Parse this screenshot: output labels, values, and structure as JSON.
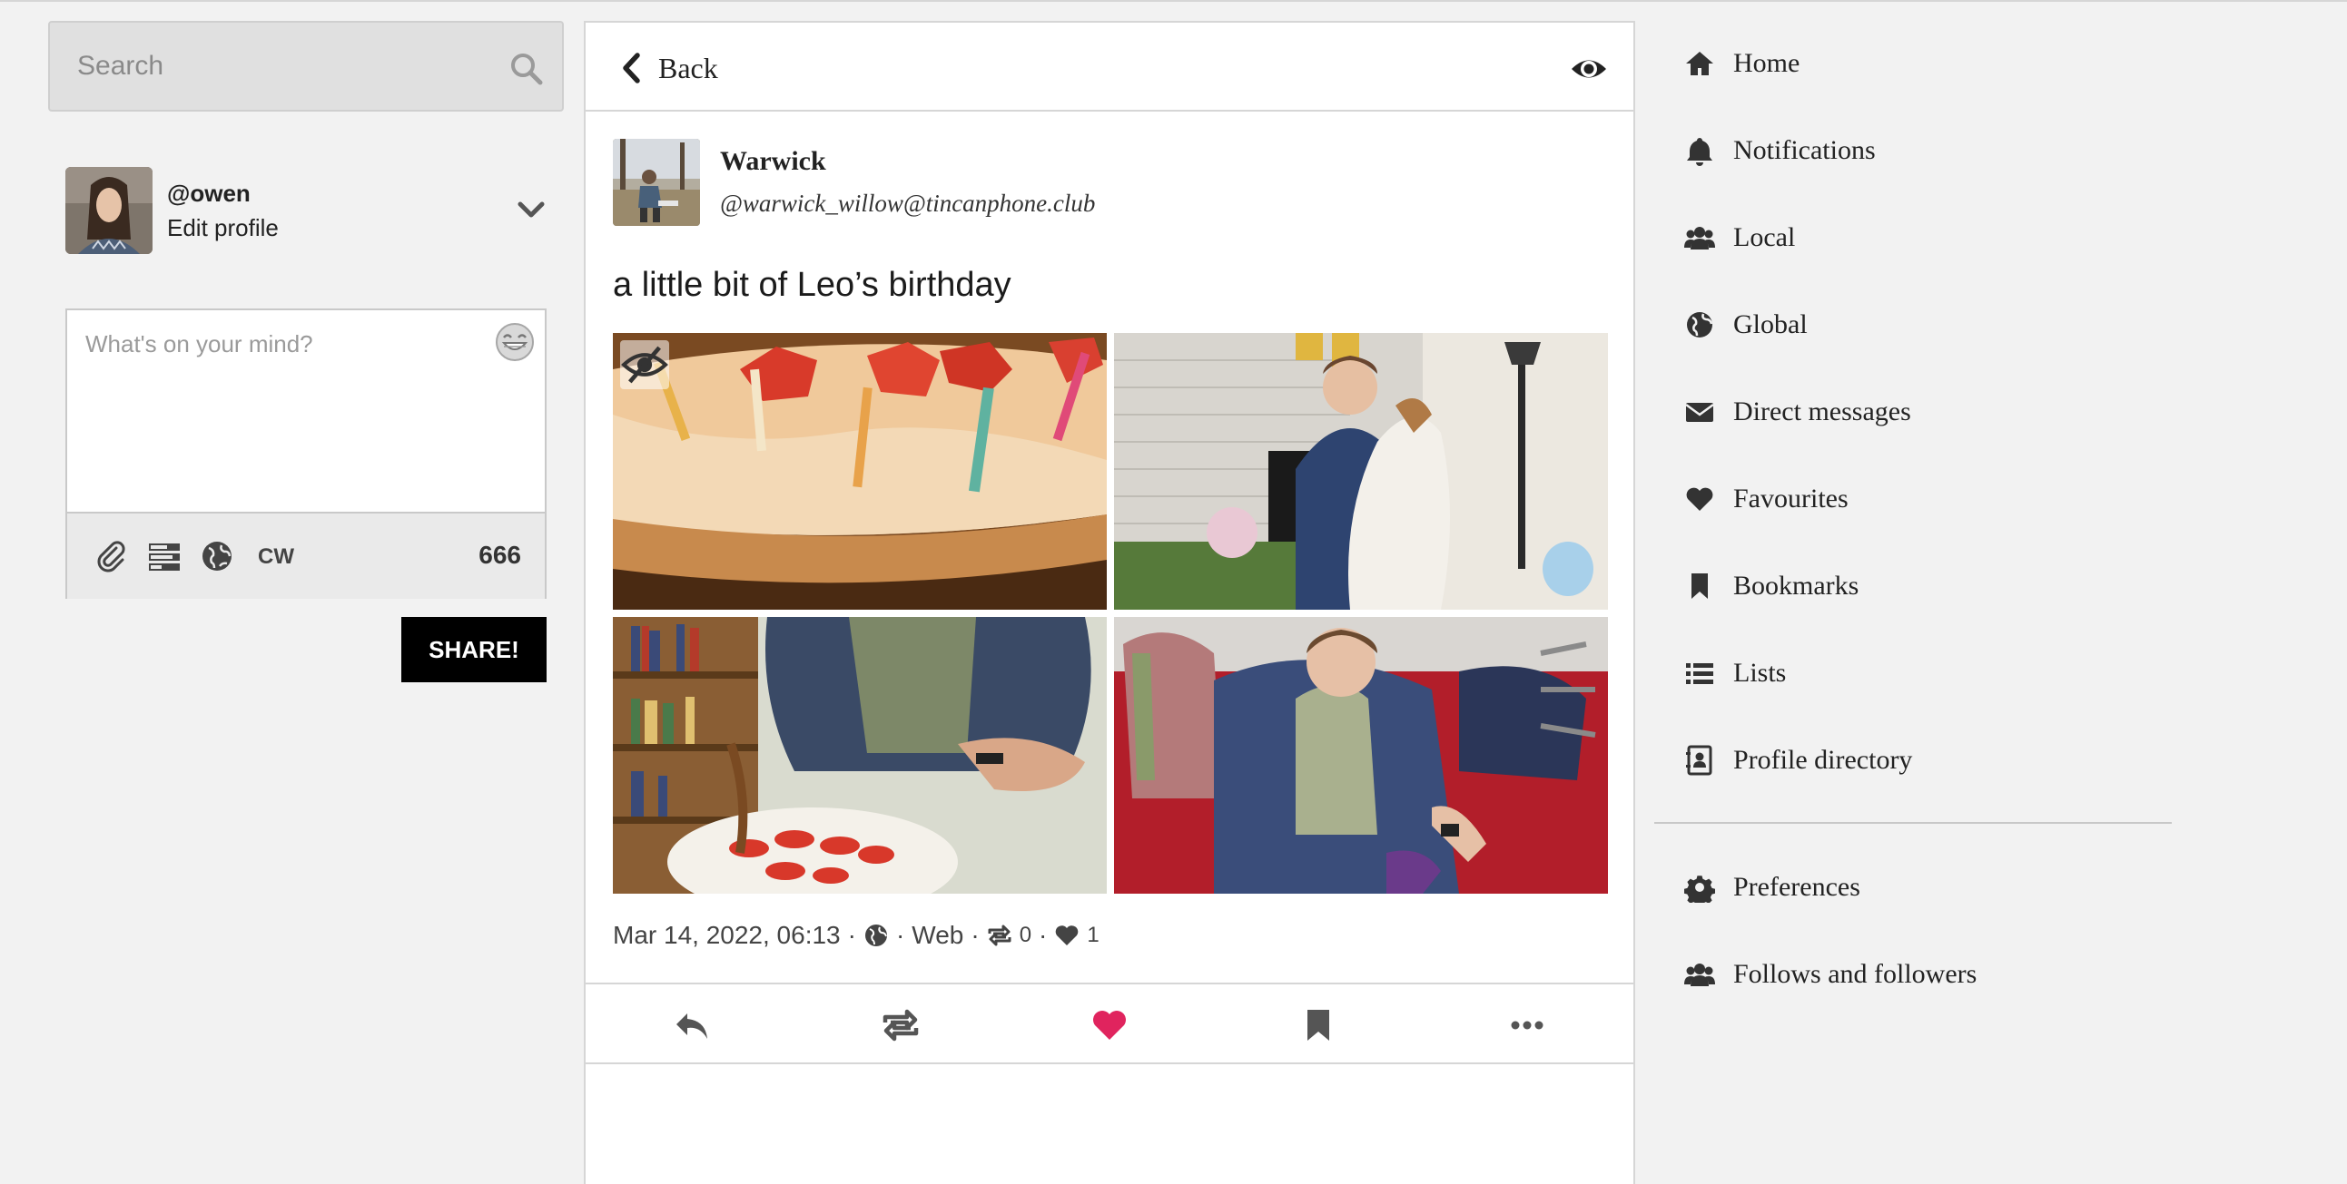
{
  "search": {
    "placeholder": "Search"
  },
  "account": {
    "handle": "@owen",
    "edit_label": "Edit profile"
  },
  "compose": {
    "placeholder": "What's on your mind?",
    "cw_label": "CW",
    "char_count": "666",
    "share_label": "SHARE!"
  },
  "header": {
    "back_label": "Back"
  },
  "status": {
    "author_name": "Warwick",
    "author_acct": "@warwick_willow@tincanphone.club",
    "text": "a little bit of Leo’s birthday",
    "date": "Mar 14, 2022, 06:13",
    "sep": "·",
    "application": "Web",
    "reblogs": "0",
    "favourites": "1"
  },
  "nav": {
    "items": [
      {
        "label": "Home",
        "icon": "home-icon"
      },
      {
        "label": "Notifications",
        "icon": "bell-icon"
      },
      {
        "label": "Local",
        "icon": "users-icon"
      },
      {
        "label": "Global",
        "icon": "globe-icon"
      },
      {
        "label": "Direct messages",
        "icon": "envelope-icon"
      },
      {
        "label": "Favourites",
        "icon": "heart-icon"
      },
      {
        "label": "Bookmarks",
        "icon": "bookmark-icon"
      },
      {
        "label": "Lists",
        "icon": "list-icon"
      },
      {
        "label": "Profile directory",
        "icon": "address-book-icon"
      }
    ],
    "secondary": [
      {
        "label": "Preferences",
        "icon": "gear-icon"
      },
      {
        "label": "Follows and followers",
        "icon": "users-icon"
      }
    ]
  },
  "colors": {
    "favourite_active": "#e0245e",
    "share_button": "#000000",
    "icon": "#282c37"
  }
}
